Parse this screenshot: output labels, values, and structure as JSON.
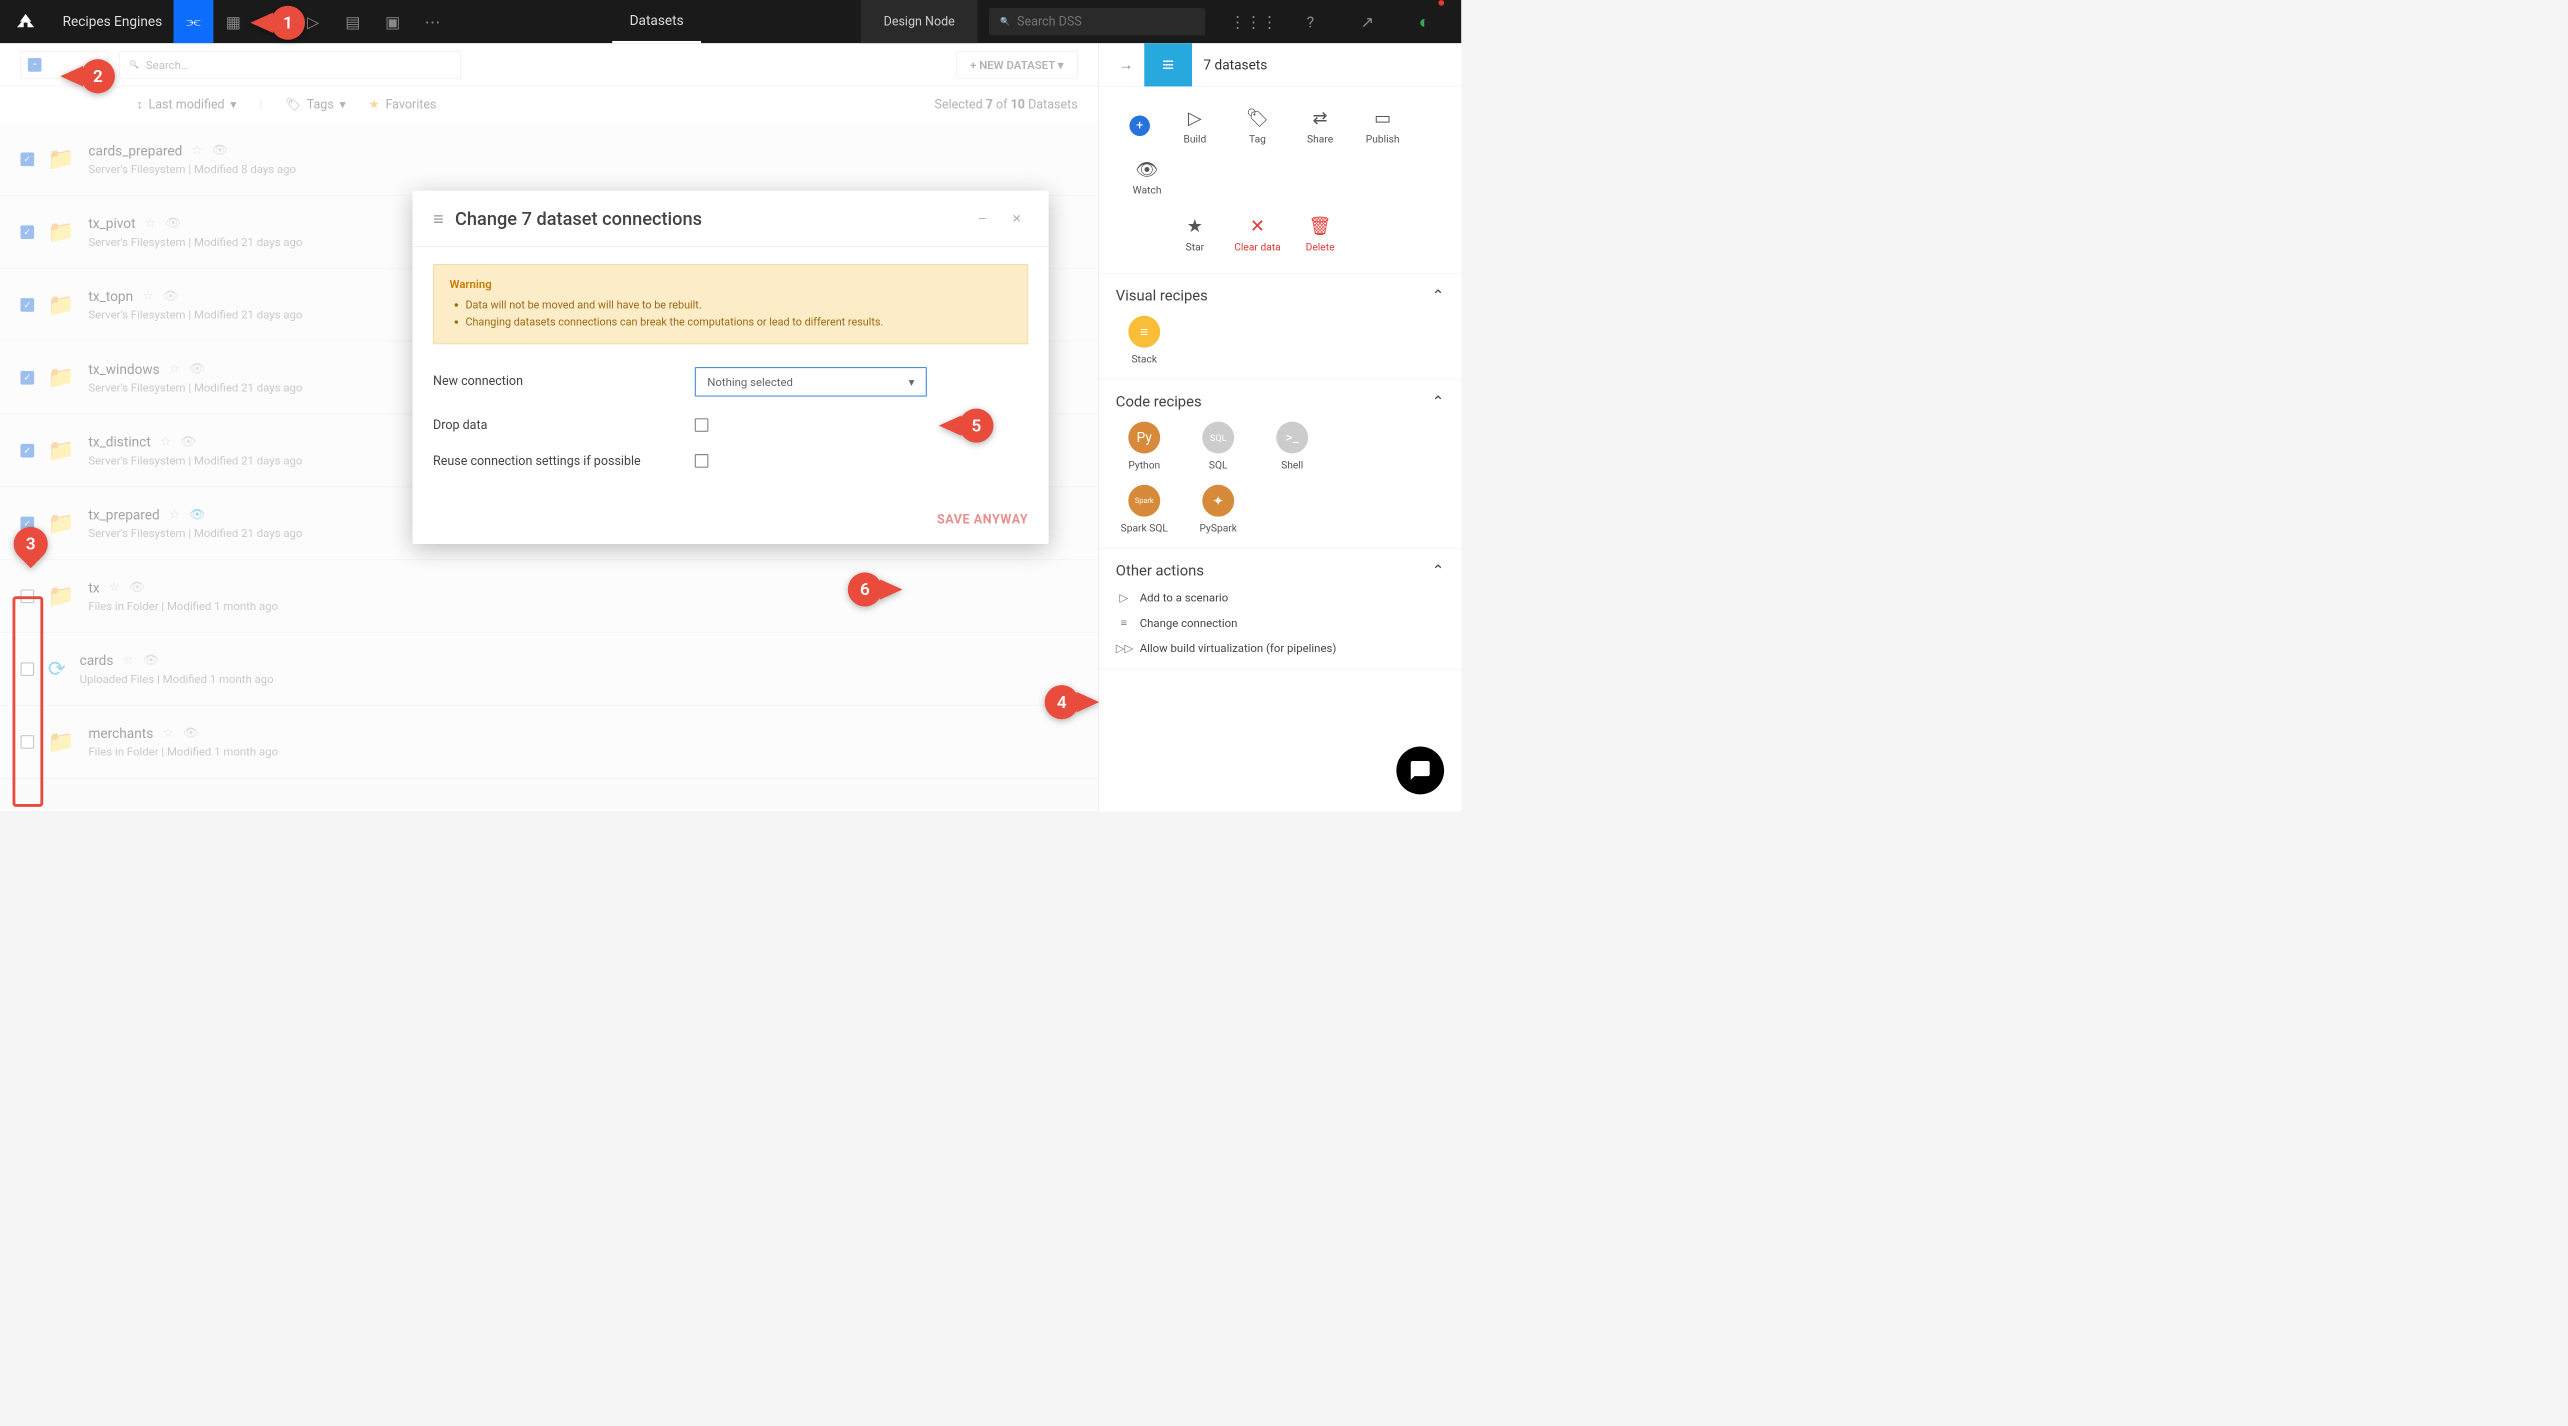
{
  "topbar": {
    "title": "Recipes Engines",
    "center_tab": "Datasets",
    "design_node": "Design Node",
    "search_placeholder": "Search DSS"
  },
  "toolbar": {
    "search_placeholder": "Search…",
    "new_dataset": "+ NEW DATASET  ▾"
  },
  "filter": {
    "sort": "Last modified",
    "tags": "Tags",
    "favorites": "Favorites",
    "selected_prefix": "Selected ",
    "selected_count": "7",
    "selected_of": " of ",
    "selected_total": "10",
    "selected_suffix": " Datasets"
  },
  "datasets": [
    {
      "name": "cards_prepared",
      "meta": "Server's Filesystem | Modified 8 days ago",
      "checked": true,
      "eye": false
    },
    {
      "name": "tx_pivot",
      "meta": "Server's Filesystem | Modified 21 days ago",
      "checked": true,
      "eye": false
    },
    {
      "name": "tx_topn",
      "meta": "Server's Filesystem | Modified 21 days ago",
      "checked": true,
      "eye": false
    },
    {
      "name": "tx_windows",
      "meta": "Server's Filesystem | Modified 21 days ago",
      "checked": true,
      "eye": false
    },
    {
      "name": "tx_distinct",
      "meta": "Server's Filesystem | Modified 21 days ago",
      "checked": true,
      "eye": false
    },
    {
      "name": "tx_prepared",
      "meta": "Server's Filesystem | Modified 21 days ago",
      "checked": true,
      "eye": true
    },
    {
      "name": "tx",
      "meta": "Files in Folder | Modified 1 month ago",
      "checked": false,
      "eye": false
    },
    {
      "name": "cards",
      "meta": "Uploaded Files | Modified 1 month ago",
      "checked": false,
      "eye": false,
      "upload": true
    },
    {
      "name": "merchants",
      "meta": "Files in Folder | Modified 1 month ago",
      "checked": false,
      "eye": false
    }
  ],
  "right": {
    "count": "7 datasets",
    "actions": {
      "build": "Build",
      "tag": "Tag",
      "share": "Share",
      "publish": "Publish",
      "watch": "Watch",
      "star": "Star",
      "clear": "Clear data",
      "delete": "Delete"
    },
    "visual_title": "Visual recipes",
    "visual": {
      "stack": "Stack"
    },
    "code_title": "Code recipes",
    "code": {
      "python": "Python",
      "sql": "SQL",
      "shell": "Shell",
      "sparksql": "Spark SQL",
      "pyspark": "PySpark"
    },
    "other_title": "Other actions",
    "other": {
      "scenario": "Add to a scenario",
      "connection": "Change connection",
      "virtualization": "Allow build virtualization (for pipelines)"
    }
  },
  "modal": {
    "title": "Change 7 dataset connections",
    "warning_title": "Warning",
    "warning_1": "Data will not be moved and will have to be rebuilt.",
    "warning_2": "Changing datasets connections can break the computations or lead to different results.",
    "new_connection": "New connection",
    "nothing_selected": "Nothing selected",
    "drop_data": "Drop data",
    "reuse": "Reuse connection settings if possible",
    "save": "SAVE ANYWAY"
  },
  "callouts": {
    "c1": "1",
    "c2": "2",
    "c3": "3",
    "c4": "4",
    "c5": "5",
    "c6": "6"
  }
}
